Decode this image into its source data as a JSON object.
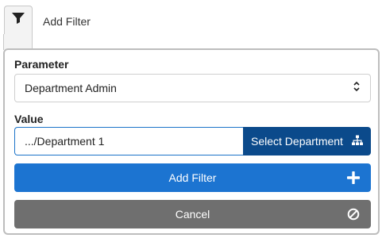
{
  "header": {
    "add_filter_label": "Add Filter"
  },
  "form": {
    "parameter_label": "Parameter",
    "parameter_selected": "Department Admin",
    "value_label": "Value",
    "value_input": ".../Department 1",
    "select_department_label": "Select Department"
  },
  "actions": {
    "add_filter_label": "Add Filter",
    "cancel_label": "Cancel"
  },
  "icons": {
    "filter": "filter-funnel-icon",
    "sort": "sort-updown-icon",
    "hierarchy": "sitemap-icon",
    "plus": "plus-icon",
    "cancel": "ban-icon"
  },
  "colors": {
    "primary": "#1c74d1",
    "dark_primary": "#0b4a8b",
    "cancel_gray": "#6f6f6f"
  }
}
